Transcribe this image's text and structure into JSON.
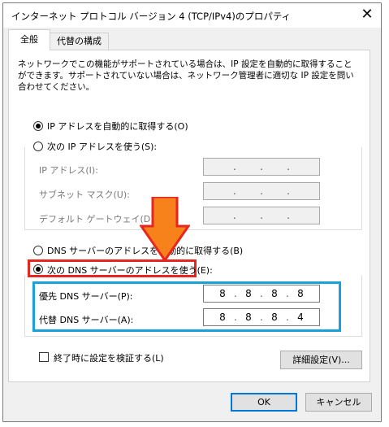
{
  "window": {
    "title": "インターネット プロトコル バージョン 4 (TCP/IPv4)のプロパティ",
    "close_glyph": "✕"
  },
  "tabs": [
    {
      "label": "全般"
    },
    {
      "label": "代替の構成"
    }
  ],
  "description": "ネットワークでこの機能がサポートされている場合は、IP 設定を自動的に取得することができます。サポートされていない場合は、ネットワーク管理者に適切な IP 設定を問い合わせてください。",
  "ip": {
    "auto_label": "IP アドレスを自動的に取得する(O)",
    "manual_label": "次の IP アドレスを使う(S):",
    "fields": [
      {
        "label": "IP アドレス(I):",
        "octets": [
          "",
          "",
          "",
          ""
        ]
      },
      {
        "label": "サブネット マスク(U):",
        "octets": [
          "",
          "",
          "",
          ""
        ]
      },
      {
        "label": "デフォルト ゲートウェイ(D):",
        "octets": [
          "",
          "",
          "",
          ""
        ]
      }
    ]
  },
  "dns": {
    "auto_label": "DNS サーバーのアドレスを自動的に取得する(B)",
    "manual_label": "次の DNS サーバーのアドレスを使う(E):",
    "preferred": {
      "label": "優先 DNS サーバー(P):",
      "octets": [
        "8",
        "8",
        "8",
        "8"
      ]
    },
    "alternate": {
      "label": "代替 DNS サーバー(A):",
      "octets": [
        "8",
        "8",
        "8",
        "4"
      ]
    }
  },
  "validate_label": "終了時に設定を検証する(L)",
  "buttons": {
    "advanced": "詳細設定(V)...",
    "ok": "OK",
    "cancel": "キャンセル"
  },
  "colors": {
    "highlight_red": "#e8251f",
    "highlight_blue": "#1aa0da",
    "arrow_orange": "#f7821b",
    "ok_border": "#0078d7"
  }
}
